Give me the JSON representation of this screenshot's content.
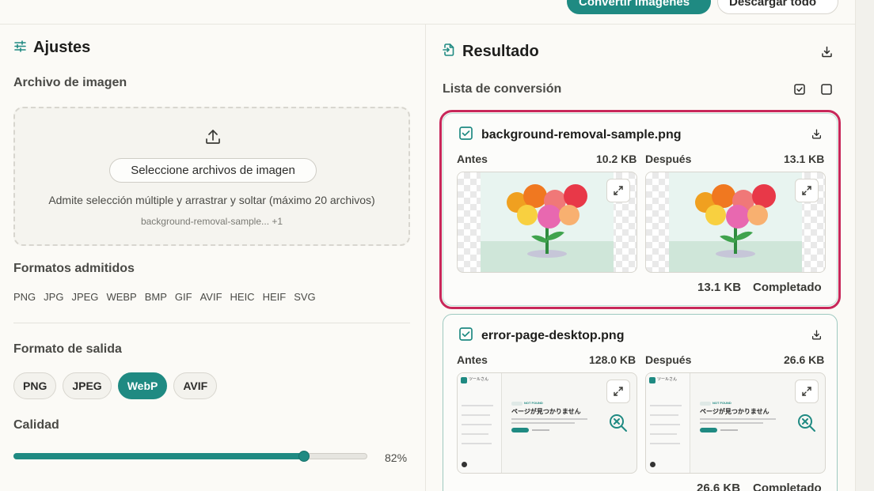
{
  "toolbar": {
    "convert_label": "Convertir imágenes",
    "download_all_label": "Descargar todo"
  },
  "settings": {
    "title": "Ajustes",
    "image_file": {
      "label": "Archivo de imagen",
      "select_label": "Seleccione archivos de imagen",
      "help": "Admite selección múltiple y arrastrar y soltar (máximo 20 archivos)",
      "selected_files": "background-removal-sample... +1"
    },
    "supported": {
      "label": "Formatos admitidos",
      "formats": [
        "PNG",
        "JPG",
        "JPEG",
        "WEBP",
        "BMP",
        "GIF",
        "AVIF",
        "HEIC",
        "HEIF",
        "SVG"
      ]
    },
    "output": {
      "label": "Formato de salida",
      "options": [
        "PNG",
        "JPEG",
        "WebP",
        "AVIF"
      ],
      "selected": "WebP"
    },
    "quality": {
      "label": "Calidad",
      "value": 82,
      "value_text": "82%"
    }
  },
  "result": {
    "title": "Resultado",
    "list_label": "Lista de conversión",
    "items": [
      {
        "name": "background-removal-sample.png",
        "before_label": "Antes",
        "before_size": "10.2 KB",
        "after_label": "Después",
        "after_size": "13.1 KB",
        "final_size": "13.1 KB",
        "status": "Completado"
      },
      {
        "name": "error-page-desktop.png",
        "before_label": "Antes",
        "before_size": "128.0 KB",
        "after_label": "Después",
        "after_size": "26.6 KB",
        "final_size": "26.6 KB",
        "status": "Completado",
        "preview": {
          "title": "ページが見つかりません",
          "badge": "NOT FOUND",
          "app_name": "ツールさん"
        }
      }
    ]
  },
  "colors": {
    "accent": "#1f8a82",
    "selected_outline": "#c8285a"
  }
}
